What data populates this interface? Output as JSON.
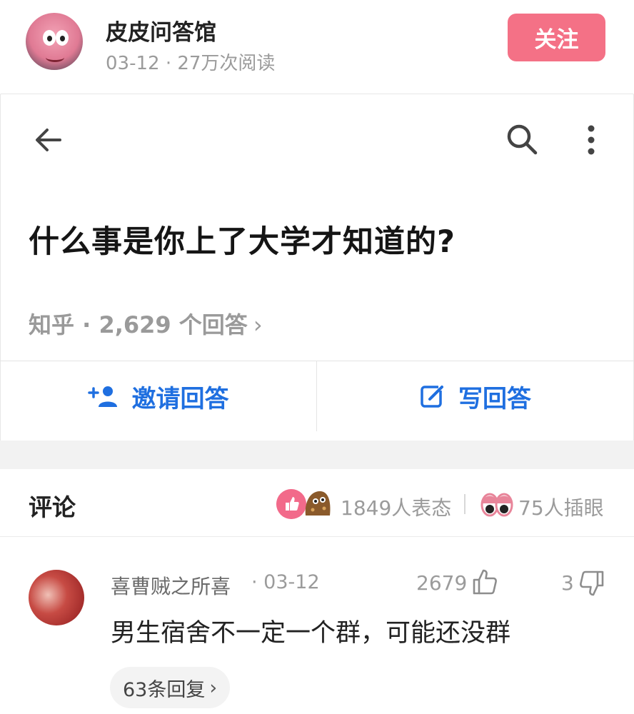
{
  "header": {
    "name": "皮皮问答馆",
    "meta": "03-12 · 27万次阅读",
    "follow_label": "关注"
  },
  "question": {
    "title": "什么事是你上了大学才知道的?",
    "source": "知乎 · 2,629 个回答",
    "chevron": "›"
  },
  "actions": {
    "invite_label": "邀请回答",
    "write_label": "写回答"
  },
  "comments": {
    "title": "评论",
    "reactions_text": "1849人表态",
    "eyes_text": "75人插眼",
    "items": [
      {
        "user": "喜曹贼之所喜",
        "date": "· 03-12",
        "likes": "2679",
        "dislikes": "3",
        "text": "男生宿舍不一定一个群，可能还没群",
        "replies_label": "63条回复",
        "replies_chevron": "›"
      }
    ]
  },
  "icons": {
    "back": "arrow-left-icon",
    "search": "search-icon",
    "more": "more-vertical-icon",
    "invite": "add-user-icon",
    "write": "edit-icon",
    "like": "thumb-up-icon",
    "dislike": "thumb-down-icon"
  },
  "colors": {
    "accent_pink": "#f47186",
    "link_blue": "#1f6fe0",
    "muted": "#9b9b9b"
  }
}
